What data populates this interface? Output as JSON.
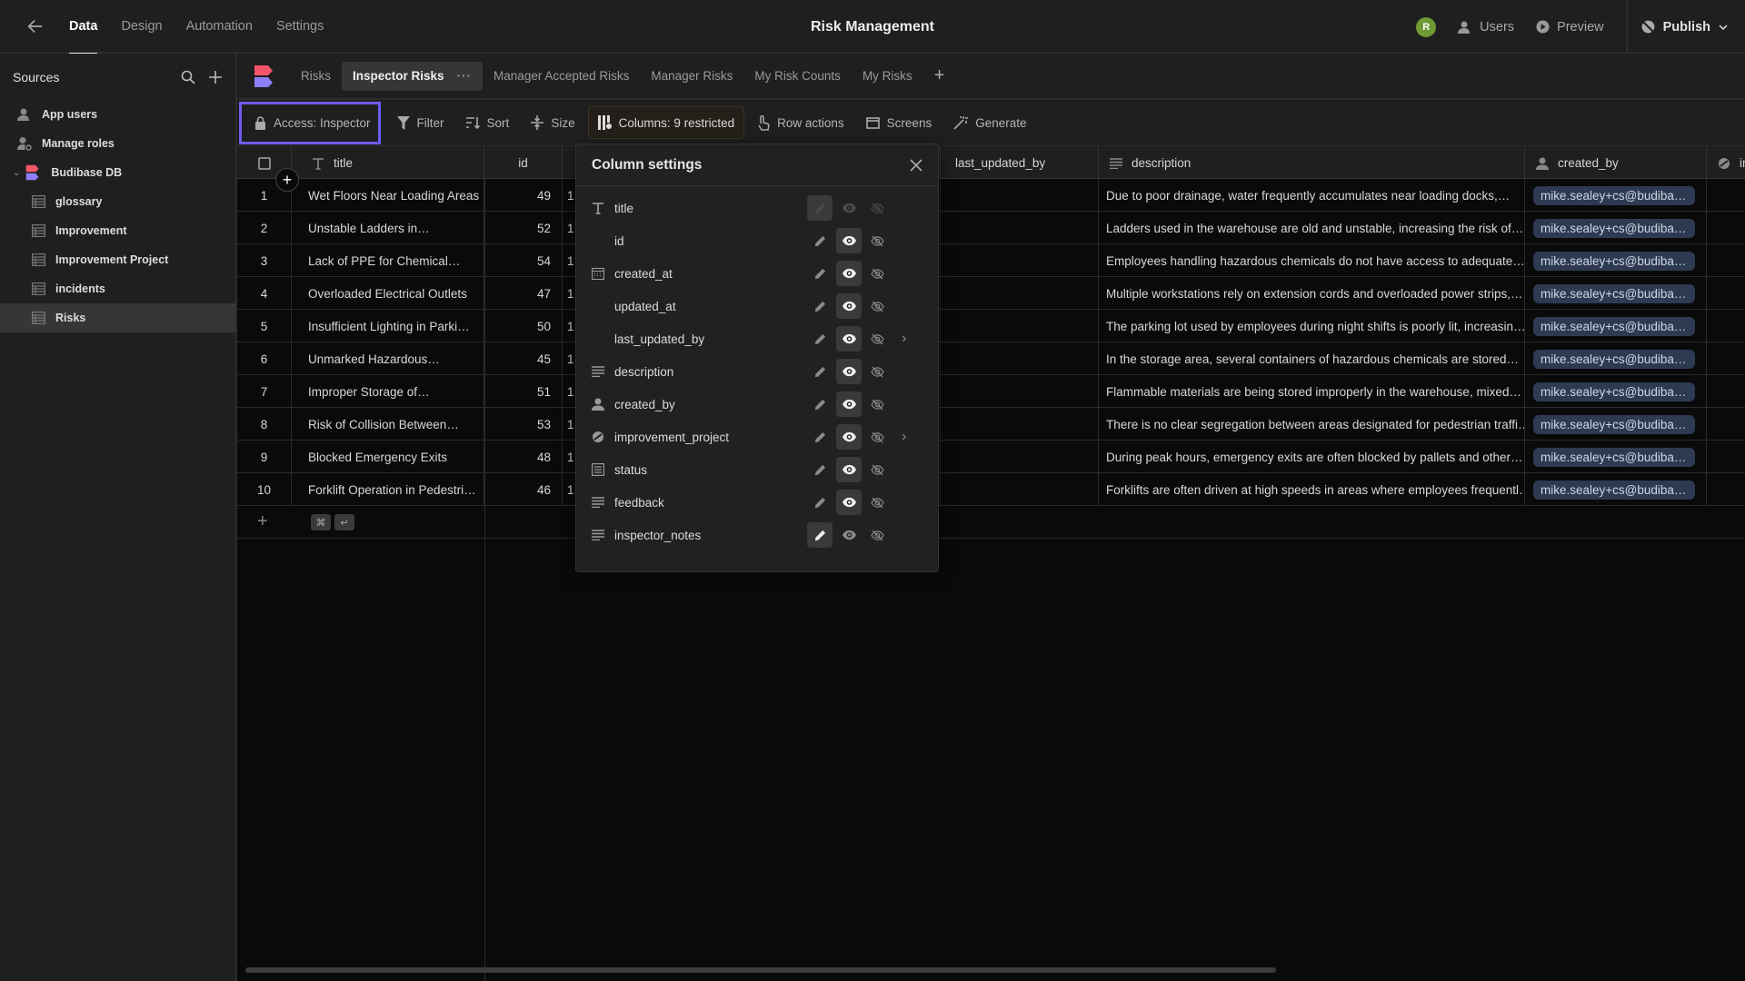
{
  "topbar": {
    "nav": [
      {
        "label": "Data",
        "active": true
      },
      {
        "label": "Design"
      },
      {
        "label": "Automation"
      },
      {
        "label": "Settings"
      }
    ],
    "app_title": "Risk Management",
    "avatar_initial": "R",
    "avatar_color": "#6f9a35",
    "users_label": "Users",
    "preview_label": "Preview",
    "publish_label": "Publish"
  },
  "sidebar": {
    "title": "Sources",
    "items": [
      {
        "label": "App users",
        "icon": "users-icon",
        "level": 0
      },
      {
        "label": "Manage roles",
        "icon": "user-gear-icon",
        "level": 0
      },
      {
        "label": "Budibase DB",
        "icon": "budibase-logo",
        "level": 0,
        "expanded": true
      },
      {
        "label": "glossary",
        "icon": "table-icon",
        "level": 1
      },
      {
        "label": "Improvement",
        "icon": "table-icon",
        "level": 1
      },
      {
        "label": "Improvement Project",
        "icon": "table-icon",
        "level": 1
      },
      {
        "label": "incidents",
        "icon": "table-icon",
        "level": 1
      },
      {
        "label": "Risks",
        "icon": "table-icon",
        "level": 1,
        "selected": true
      }
    ]
  },
  "view_tabs": [
    {
      "label": "Risks"
    },
    {
      "label": "Inspector Risks",
      "active": true
    },
    {
      "label": "Manager Accepted Risks"
    },
    {
      "label": "Manager Risks"
    },
    {
      "label": "My Risk Counts"
    },
    {
      "label": "My Risks"
    }
  ],
  "toolbar": {
    "access": "Access: Inspector",
    "filter": "Filter",
    "sort": "Sort",
    "size": "Size",
    "columns": "Columns: 9 restricted",
    "row_actions": "Row actions",
    "screens": "Screens",
    "generate": "Generate",
    "accent": "#6c5cf2"
  },
  "grid": {
    "headers": {
      "title": "title",
      "id": "id",
      "last_updated_by": "last_updated_by",
      "description": "description",
      "created_by": "created_by",
      "next": "in"
    },
    "rows": [
      {
        "n": "1",
        "title": "Wet Floors Near Loading Areas",
        "id": "49",
        "created_at": "1",
        "description": "Due to poor drainage, water frequently accumulates near loading docks,…",
        "created_by": "mike.sealey+cs@budibas…"
      },
      {
        "n": "2",
        "title": "Unstable Ladders in…",
        "id": "52",
        "created_at": "1",
        "description": "Ladders used in the warehouse are old and unstable, increasing the risk of…",
        "created_by": "mike.sealey+cs@budibas…"
      },
      {
        "n": "3",
        "title": "Lack of PPE for Chemical…",
        "id": "54",
        "created_at": "1",
        "description": "Employees handling hazardous chemicals do not have access to adequate…",
        "created_by": "mike.sealey+cs@budibas…"
      },
      {
        "n": "4",
        "title": "Overloaded Electrical Outlets",
        "id": "47",
        "created_at": "1",
        "description": "Multiple workstations rely on extension cords and overloaded power strips,…",
        "created_by": "mike.sealey+cs@budibas…"
      },
      {
        "n": "5",
        "title": "Insufficient Lighting in Parki…",
        "id": "50",
        "created_at": "1",
        "description": "The parking lot used by employees during night shifts is poorly lit, increasin…",
        "created_by": "mike.sealey+cs@budibas…"
      },
      {
        "n": "6",
        "title": "Unmarked Hazardous…",
        "id": "45",
        "created_at": "1",
        "description": "In the storage area, several containers of hazardous chemicals are stored…",
        "created_by": "mike.sealey+cs@budibas…"
      },
      {
        "n": "7",
        "title": "Improper Storage of…",
        "id": "51",
        "created_at": "1",
        "description": "Flammable materials are being stored improperly in the warehouse, mixed…",
        "created_by": "mike.sealey+cs@budibas…"
      },
      {
        "n": "8",
        "title": "Risk of Collision Between…",
        "id": "53",
        "created_at": "1",
        "description": "There is no clear segregation between areas designated for pedestrian traffi…",
        "created_by": "mike.sealey+cs@budibas…"
      },
      {
        "n": "9",
        "title": "Blocked Emergency Exits",
        "id": "48",
        "created_at": "1",
        "description": "During peak hours, emergency exits are often blocked by pallets and other…",
        "created_by": "mike.sealey+cs@budibas…"
      },
      {
        "n": "10",
        "title": "Forklift Operation in Pedestri…",
        "id": "46",
        "created_at": "1",
        "description": "Forklifts are often driven at high speeds in areas where employees frequentl…",
        "created_by": "mike.sealey+cs@budibas…"
      }
    ],
    "shortcut_keys": [
      "⌘",
      "↵"
    ]
  },
  "column_settings": {
    "title": "Column settings",
    "columns": [
      {
        "name": "title",
        "icon": "text-icon",
        "state": "locked"
      },
      {
        "name": "id",
        "icon": "",
        "state": "visible"
      },
      {
        "name": "created_at",
        "icon": "calendar-icon",
        "state": "visible"
      },
      {
        "name": "updated_at",
        "icon": "",
        "state": "visible"
      },
      {
        "name": "last_updated_by",
        "icon": "",
        "state": "visible",
        "expandable": true
      },
      {
        "name": "description",
        "icon": "longtext-icon",
        "state": "visible"
      },
      {
        "name": "created_by",
        "icon": "user-icon",
        "state": "visible"
      },
      {
        "name": "improvement_project",
        "icon": "link-icon",
        "state": "visible",
        "expandable": true
      },
      {
        "name": "status",
        "icon": "options-icon",
        "state": "visible"
      },
      {
        "name": "feedback",
        "icon": "longtext-icon",
        "state": "visible"
      },
      {
        "name": "inspector_notes",
        "icon": "longtext-icon",
        "state": "editable"
      }
    ]
  }
}
